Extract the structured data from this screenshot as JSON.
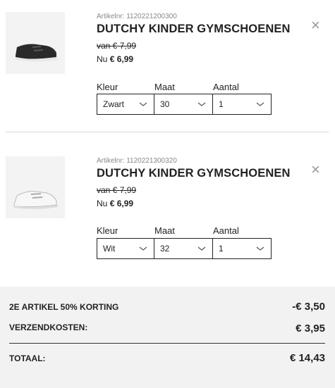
{
  "items": [
    {
      "artnr": "Artikelnr: 1120221200300",
      "title": "DUTCHY KINDER GYMSCHOENEN",
      "old_price": "van € 7,99",
      "new_price_prefix": "Nu ",
      "new_price": "€ 6,99",
      "color_label": "Kleur",
      "size_label": "Maat",
      "qty_label": "Aantal",
      "color_value": "Zwart",
      "size_value": "30",
      "qty_value": "1",
      "shoe_color": "#2a2a2a",
      "close_icon": "×"
    },
    {
      "artnr": "Artikelnr: 1120221300320",
      "title": "DUTCHY KINDER GYMSCHOENEN",
      "old_price": "van € 7,99",
      "new_price_prefix": "Nu ",
      "new_price": "€ 6,99",
      "color_label": "Kleur",
      "size_label": "Maat",
      "qty_label": "Aantal",
      "color_value": "Wit",
      "size_value": "32",
      "qty_value": "1",
      "shoe_color": "#f4f4f4",
      "close_icon": "×"
    }
  ],
  "summary": {
    "discount_label": "2E ARTIKEL 50% KORTING",
    "discount_value": "-€ 3,50",
    "shipping_label": "VERZENDKOSTEN:",
    "shipping_value": "€ 3,95",
    "total_label": "TOTAAL:",
    "total_value": "€ 14,43"
  }
}
